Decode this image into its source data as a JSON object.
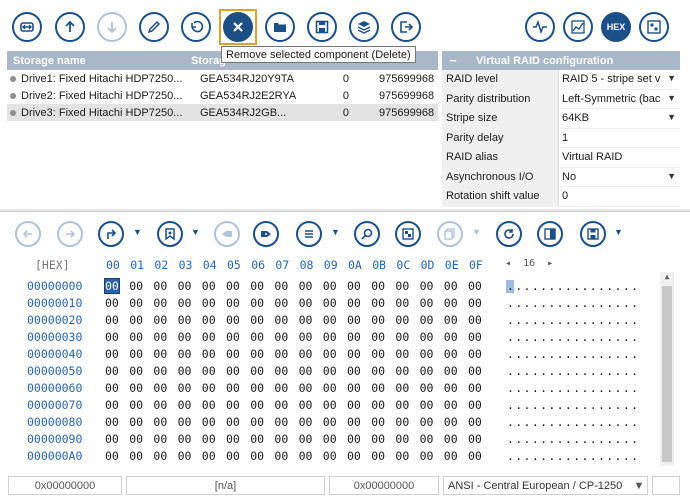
{
  "tooltip": "Remove selected component (Delete)",
  "toolbar": {
    "buttons": [
      "raid-icon",
      "up-arrow-icon",
      "down-arrow-icon",
      "pencil-icon",
      "undo-icon",
      "close-icon",
      "folder-icon",
      "save-icon",
      "layers-icon",
      "export-icon",
      "waveform-icon",
      "chart-icon",
      "hex-label",
      "grid-icon"
    ],
    "hex_label": "HEX"
  },
  "storage": {
    "columns": [
      "Storage name",
      "Storag"
    ],
    "rows": [
      {
        "name": "Drive1: Fixed Hitachi HDP7250...",
        "serial": "GEA534RJ20Y9TA",
        "zero": "0",
        "size": "975699968"
      },
      {
        "name": "Drive2: Fixed Hitachi HDP7250...",
        "serial": "GEA534RJ2E2RYA",
        "zero": "0",
        "size": "975699968"
      },
      {
        "name": "Drive3: Fixed Hitachi HDP7250...",
        "serial": "GEA534RJ2GB...",
        "zero": "0",
        "size": "975699968"
      }
    ]
  },
  "raid": {
    "title": "Virtual RAID configuration",
    "collapse": "−",
    "rows": [
      {
        "key": "RAID level",
        "value": "RAID 5 - stripe set v",
        "dropdown": true
      },
      {
        "key": "Parity distribution",
        "value": "Left-Symmetric (bac",
        "dropdown": true
      },
      {
        "key": "Stripe size",
        "value": "64KB",
        "dropdown": true
      },
      {
        "key": "Parity delay",
        "value": "1",
        "dropdown": false
      },
      {
        "key": "RAID alias",
        "value": "Virtual RAID",
        "dropdown": false
      },
      {
        "key": "Asynchronous I/O",
        "value": "No",
        "dropdown": true
      },
      {
        "key": "Rotation shift value",
        "value": "0",
        "dropdown": false
      }
    ]
  },
  "hex": {
    "label": "[HEX]",
    "columns": [
      "00",
      "01",
      "02",
      "03",
      "04",
      "05",
      "06",
      "07",
      "08",
      "09",
      "0A",
      "0B",
      "0C",
      "0D",
      "0E",
      "0F"
    ],
    "page_prev": "◂",
    "page_num": "16",
    "page_next": "▸",
    "offsets": [
      "00000000",
      "00000010",
      "00000020",
      "00000030",
      "00000040",
      "00000050",
      "00000060",
      "00000070",
      "00000080",
      "00000090",
      "000000A0"
    ],
    "byte_value": "00",
    "ascii_line": "................"
  },
  "status": {
    "offset_left": "0x00000000",
    "selection": "[n/a]",
    "offset_right": "0x00000000",
    "encoding": "ANSI - Central European / CP-1250",
    "encoding_arrow": "▼"
  },
  "colors": {
    "accent": "#1d4f87",
    "header": "#a9b7c6",
    "highlight": "#e0a02b",
    "hex_blue": "#2a64a8"
  }
}
